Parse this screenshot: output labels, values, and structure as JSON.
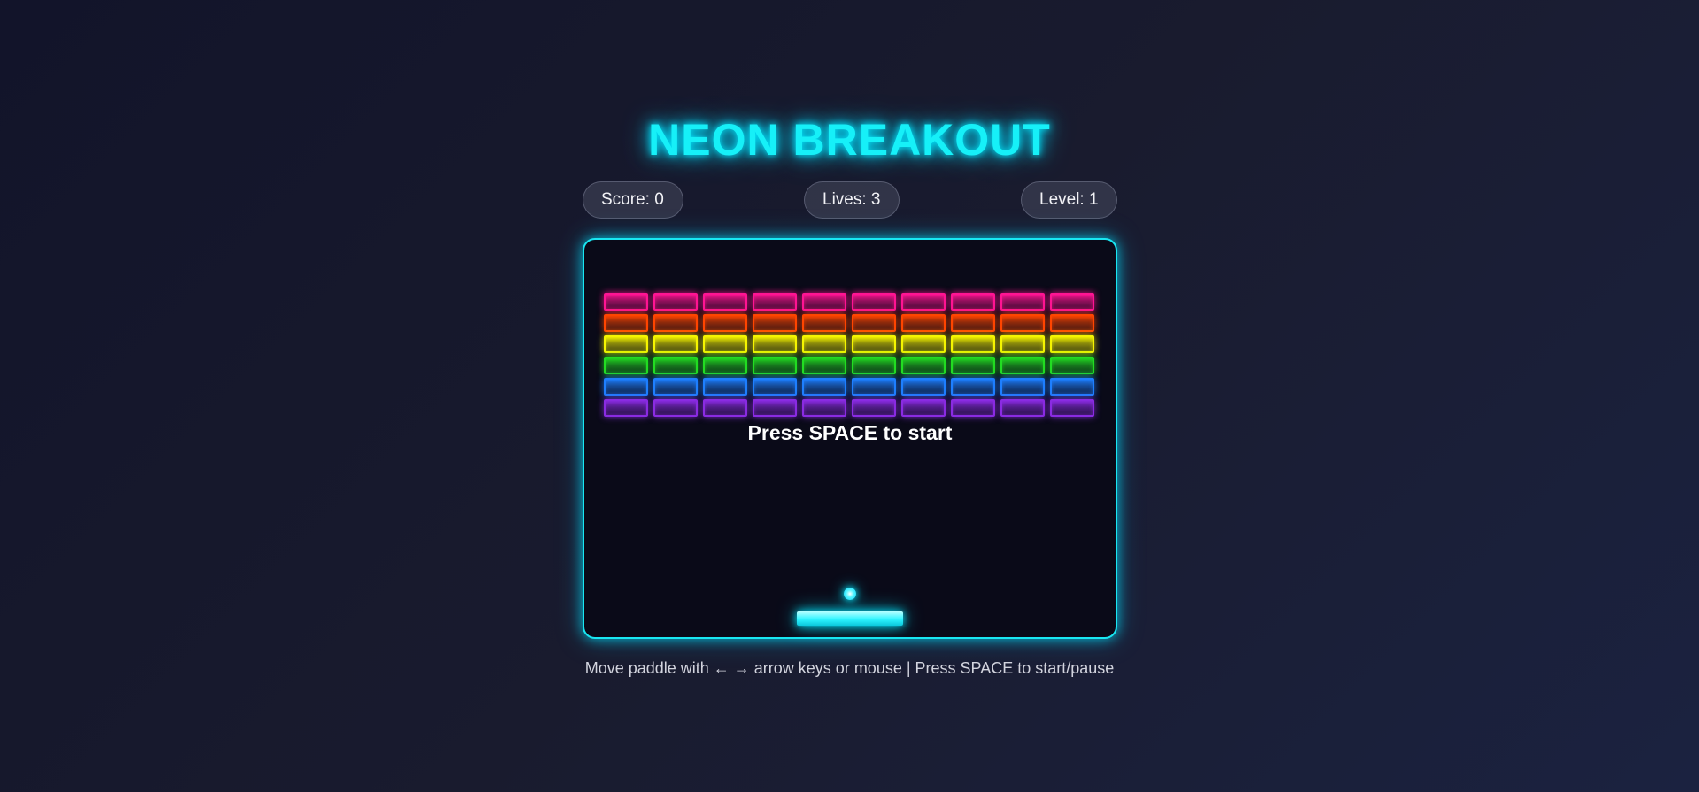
{
  "header": {
    "title": "NEON BREAKOUT"
  },
  "stats": {
    "score_label": "Score: 0",
    "lives_label": "Lives: 3",
    "level_label": "Level: 1"
  },
  "game": {
    "start_message": "Press SPACE to start",
    "bricks": {
      "columns": 10,
      "rows": [
        {
          "color": "#ff1493",
          "name": "pink"
        },
        {
          "color": "#ff4500",
          "name": "orange"
        },
        {
          "color": "#f5f500",
          "name": "yellow"
        },
        {
          "color": "#22dd22",
          "name": "green"
        },
        {
          "color": "#1e7fff",
          "name": "blue"
        },
        {
          "color": "#8a2be2",
          "name": "purple"
        }
      ]
    },
    "accent_color": "#16f0f8"
  },
  "footer": {
    "instructions": "Move paddle with ← → arrow keys or mouse | Press SPACE to start/pause"
  }
}
